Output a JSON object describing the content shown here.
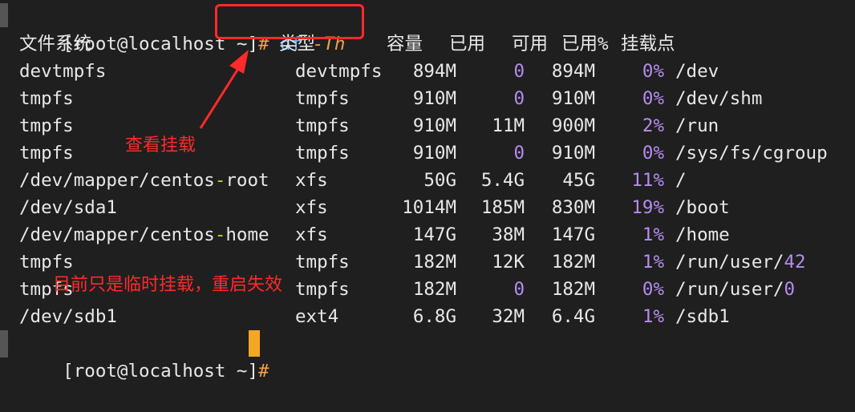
{
  "prompt": {
    "user_host": "[root@localhost ~]",
    "symbol": "# ",
    "command": "df",
    "flag": "-Th"
  },
  "headers": [
    "文件系统",
    "类型",
    "容量",
    "已用",
    "可用",
    "已用%",
    "挂载点"
  ],
  "rows": [
    {
      "fs": "devtmpfs",
      "type": "devtmpfs",
      "size": "894M",
      "used": "0",
      "avail": "894M",
      "pct": "0%",
      "mount": "/dev"
    },
    {
      "fs": "tmpfs",
      "type": "tmpfs",
      "size": "910M",
      "used": "0",
      "avail": "910M",
      "pct": "0%",
      "mount": "/dev/shm"
    },
    {
      "fs": "tmpfs",
      "type": "tmpfs",
      "size": "910M",
      "used": "11M",
      "avail": "900M",
      "pct": "2%",
      "mount": "/run"
    },
    {
      "fs": "tmpfs",
      "type": "tmpfs",
      "size": "910M",
      "used": "0",
      "avail": "910M",
      "pct": "0%",
      "mount": "/sys/fs/cgroup"
    },
    {
      "fs": "/dev/mapper/centos-root",
      "type": "xfs",
      "size": "50G",
      "used": "5.4G",
      "avail": "45G",
      "pct": "11%",
      "mount": "/"
    },
    {
      "fs": "/dev/sda1",
      "type": "xfs",
      "size": "1014M",
      "used": "185M",
      "avail": "830M",
      "pct": "19%",
      "mount": "/boot"
    },
    {
      "fs": "/dev/mapper/centos-home",
      "type": "xfs",
      "size": "147G",
      "used": "38M",
      "avail": "147G",
      "pct": "1%",
      "mount": "/home"
    },
    {
      "fs": "tmpfs",
      "type": "tmpfs",
      "size": "182M",
      "used": "12K",
      "avail": "182M",
      "pct": "1%",
      "mount": "/run/user/42"
    },
    {
      "fs": "tmpfs",
      "type": "tmpfs",
      "size": "182M",
      "used": "0",
      "avail": "182M",
      "pct": "0%",
      "mount": "/run/user/0"
    },
    {
      "fs": "/dev/sdb1",
      "type": "ext4",
      "size": "6.8G",
      "used": "32M",
      "avail": "6.4G",
      "pct": "1%",
      "mount": "/sdb1"
    }
  ],
  "annotations": {
    "arrow_note": "查看挂载",
    "temp_note": "目前只是临时挂载，重启失效"
  },
  "colors": {
    "background": "#1f1f1f",
    "text": "#e8e8e8",
    "number_accent": "#b58cf0",
    "command": "#6fb3ff",
    "prompt_symbol": "#f0a14a",
    "cursor": "#f5a623",
    "annotation": "#ff2a2a"
  }
}
